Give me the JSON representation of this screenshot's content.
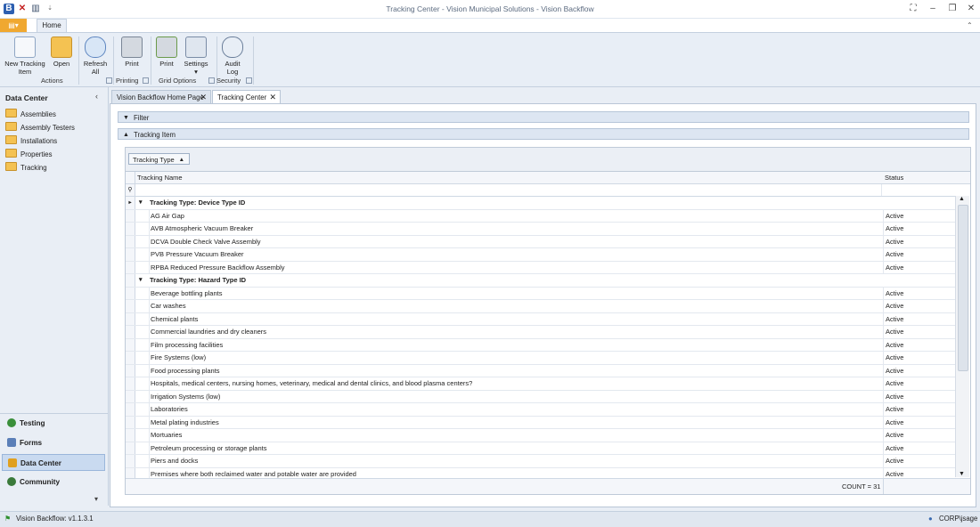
{
  "window": {
    "title": "Tracking Center - Vision Municipal Solutions - Vision Backflow"
  },
  "ribbon": {
    "tabs": [
      "Home"
    ],
    "buttons": {
      "new_tracking_item": "New Tracking\nItem",
      "open": "Open",
      "refresh_all": "Refresh\nAll",
      "print_printing": "Print",
      "print_grid": "Print",
      "settings": "Settings",
      "audit_log": "Audit\nLog"
    },
    "groups": {
      "actions": "Actions",
      "printing": "Printing",
      "grid_options": "Grid Options",
      "security": "Security"
    }
  },
  "sidebar": {
    "header": "Data Center",
    "tree": [
      "Assemblies",
      "Assembly Testers",
      "Installations",
      "Properties",
      "Tracking"
    ],
    "nav": [
      {
        "label": "Testing",
        "icon": "testing-icon",
        "color": "#3a8f3a"
      },
      {
        "label": "Forms",
        "icon": "forms-icon",
        "color": "#5b7fb8"
      },
      {
        "label": "Data Center",
        "icon": "folder-icon",
        "color": "#e0a020"
      },
      {
        "label": "Community",
        "icon": "community-icon",
        "color": "#3a7a3a"
      }
    ]
  },
  "doc_tabs": [
    "Vision Backflow Home Page",
    "Tracking Center"
  ],
  "sections": {
    "filter": "Filter",
    "tracking_item": "Tracking Item"
  },
  "grid": {
    "group_chip": "Tracking Type",
    "columns": [
      "Tracking Name",
      "Status"
    ],
    "groups": [
      {
        "label": "Tracking Type: Device Type ID",
        "rows": [
          {
            "name": "AG Air Gap",
            "status": "Active"
          },
          {
            "name": "AVB Atmospheric Vacuum Breaker",
            "status": "Active"
          },
          {
            "name": "DCVA Double Check Valve Assembly",
            "status": "Active"
          },
          {
            "name": "PVB Pressure Vacuum Breaker",
            "status": "Active"
          },
          {
            "name": "RPBA Reduced Pressure Backflow Assembly",
            "status": "Active"
          }
        ]
      },
      {
        "label": "Tracking Type: Hazard Type ID",
        "rows": [
          {
            "name": "Beverage bottling plants",
            "status": "Active"
          },
          {
            "name": "Car washes",
            "status": "Active"
          },
          {
            "name": "Chemical plants",
            "status": "Active"
          },
          {
            "name": "Commercial laundries and dry cleaners",
            "status": "Active"
          },
          {
            "name": "Film processing facilities",
            "status": "Active"
          },
          {
            "name": "Fire Systems (low)",
            "status": "Active"
          },
          {
            "name": "Food processing plants",
            "status": "Active"
          },
          {
            "name": "Hospitals, medical centers, nursing homes, veterinary, medical and dental clinics, and blood plasma centers?",
            "status": "Active"
          },
          {
            "name": "Irrigation Systems (low)",
            "status": "Active"
          },
          {
            "name": "Laboratories",
            "status": "Active"
          },
          {
            "name": "Metal plating industries",
            "status": "Active"
          },
          {
            "name": "Mortuaries",
            "status": "Active"
          },
          {
            "name": "Petroleum processing or storage plants",
            "status": "Active"
          },
          {
            "name": "Piers and docks",
            "status": "Active"
          },
          {
            "name": "Premises where both reclaimed water and potable water are provided",
            "status": "Active"
          }
        ]
      }
    ],
    "count": "COUNT = 31"
  },
  "statusbar": {
    "version": "Vision Backflow: v1.1.3.1",
    "user": "CORP\\jsage"
  }
}
